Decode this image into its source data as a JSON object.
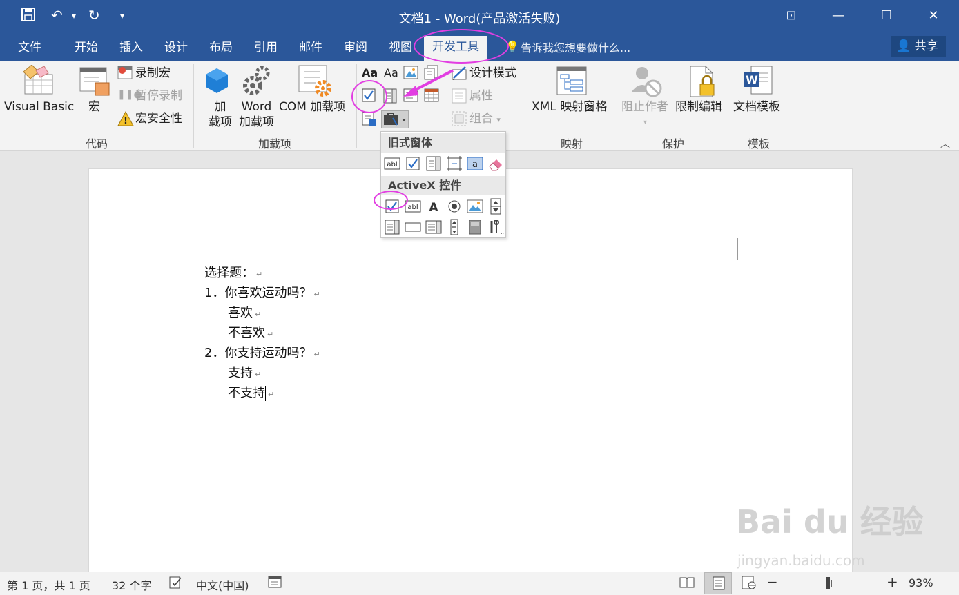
{
  "window": {
    "title": "文档1 - Word(产品激活失败)",
    "qa_save": "💾",
    "qa_undo": "↶",
    "qa_redo": "↻",
    "qa_more": "▾",
    "ribbon_display": "⊡",
    "minimize": "—",
    "maximize": "☐",
    "close": "✕"
  },
  "tabs": [
    "文件",
    "开始",
    "插入",
    "设计",
    "布局",
    "引用",
    "邮件",
    "审阅",
    "视图",
    "开发工具"
  ],
  "tell_me": "告诉我您想要做什么...",
  "share": "共享",
  "ribbon": {
    "code": {
      "label": "代码",
      "visual_basic": "Visual Basic",
      "macro": "宏",
      "record_macro": "录制宏",
      "pause_recording": "暂停录制",
      "macro_security": "宏安全性"
    },
    "addins": {
      "label": "加载项",
      "addins_line1": "加",
      "addins_line2": "载项",
      "word_addins_line1": "Word",
      "word_addins_line2": "加载项",
      "com_addins": "COM 加载项"
    },
    "controls": {
      "design_mode": "设计模式",
      "properties": "属性",
      "group": "组合"
    },
    "mapping": {
      "label": "映射",
      "xml_pane": "XML 映射窗格"
    },
    "protect": {
      "label": "保护",
      "block_authors": "阻止作者",
      "restrict_editing": "限制编辑"
    },
    "templates": {
      "label": "模板",
      "document_template": "文档模板"
    }
  },
  "controls_menu": {
    "legacy_header": "旧式窗体",
    "activex_header": "ActiveX 控件"
  },
  "document": {
    "lines": [
      "选择题：",
      "1．你喜欢运动吗？",
      "喜欢",
      "不喜欢",
      "2．你支持运动吗？",
      "支持",
      "不支持"
    ],
    "paragraph_mark": "↵"
  },
  "status": {
    "page": "第 1 页，共 1 页",
    "words": "32 个字",
    "language": "中文(中国)",
    "zoom": "93%",
    "zoom_value": 93
  },
  "watermark": {
    "logo": "Bai du 经验",
    "url": "jingyan.baidu.com"
  },
  "colors": {
    "accent": "#2b579a",
    "annotation": "#e23ee2"
  }
}
